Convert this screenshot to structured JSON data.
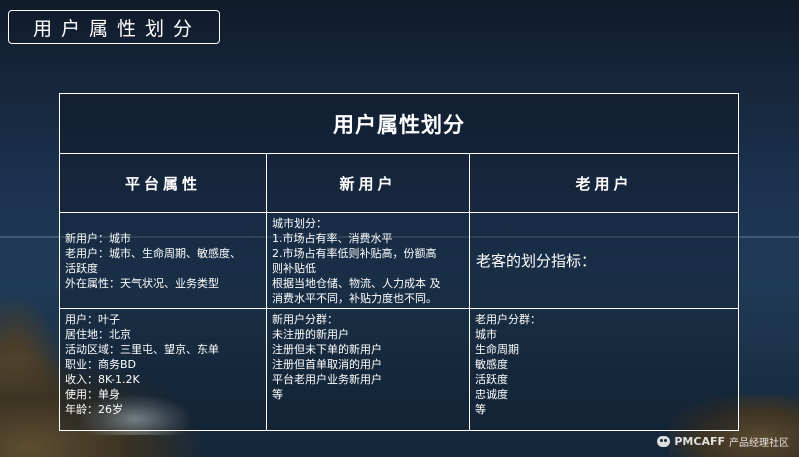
{
  "slide": {
    "title": "用户属性划分"
  },
  "table": {
    "title": "用户属性划分",
    "columns": [
      "平台属性",
      "新用户",
      "老用户"
    ],
    "row1": {
      "platform": [
        "新用户：城市",
        "老用户：城市、生命周期、敏感度、",
        "活跃度",
        "外在属性：天气状况、业务类型"
      ],
      "new_user": [
        "城市划分：",
        "1.市场占有率、消费水平",
        "2.市场占有率低则补贴高，份额高",
        "则补贴低",
        "根据当地仓储、物流、人力成本 及",
        "消费水平不同，补贴力度也不同。"
      ],
      "old_user": "老客的划分指标："
    },
    "row2": {
      "platform": [
        "用户：叶子",
        "居住地：北京",
        "活动区域：三里屯、望京、东单",
        "职业：商务BD",
        "收入：8K-1.2K",
        "使用：单身",
        "年龄：26岁"
      ],
      "new_user": [
        "新用户分群：",
        "未注册的新用户",
        "注册但未下单的新用户",
        "注册但首单取消的用户",
        "平台老用户业务新用户",
        "等"
      ],
      "old_user": [
        "老用户分群：",
        "城市",
        "生命周期",
        "敏感度",
        "活跃度",
        "忠诚度",
        "等"
      ]
    }
  },
  "watermark": {
    "brand": "PMCAFF",
    "text": "产品经理社区",
    "icon": "chat-bubble-icon"
  }
}
